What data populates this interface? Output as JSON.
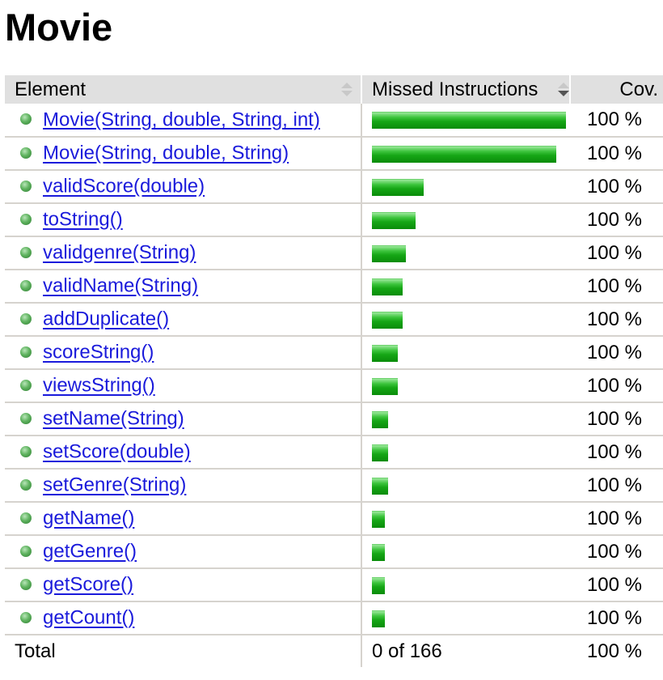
{
  "title": "Movie",
  "table": {
    "headers": {
      "element": "Element",
      "missed": "Missed Instructions",
      "cov": "Cov."
    },
    "sort": {
      "element": "sortable",
      "missed": "sorted-descending"
    },
    "rows": [
      {
        "name": "Movie(String, double, String, int)",
        "bar_fraction": 1.0,
        "cov": "100 %"
      },
      {
        "name": "Movie(String, double, String)",
        "bar_fraction": 0.95,
        "cov": "100 %"
      },
      {
        "name": "validScore(double)",
        "bar_fraction": 0.265,
        "cov": "100 %"
      },
      {
        "name": "toString()",
        "bar_fraction": 0.225,
        "cov": "100 %"
      },
      {
        "name": "validgenre(String)",
        "bar_fraction": 0.175,
        "cov": "100 %"
      },
      {
        "name": "validName(String)",
        "bar_fraction": 0.158,
        "cov": "100 %"
      },
      {
        "name": "addDuplicate()",
        "bar_fraction": 0.158,
        "cov": "100 %"
      },
      {
        "name": "scoreString()",
        "bar_fraction": 0.133,
        "cov": "100 %"
      },
      {
        "name": "viewsString()",
        "bar_fraction": 0.133,
        "cov": "100 %"
      },
      {
        "name": "setName(String)",
        "bar_fraction": 0.083,
        "cov": "100 %"
      },
      {
        "name": "setScore(double)",
        "bar_fraction": 0.083,
        "cov": "100 %"
      },
      {
        "name": "setGenre(String)",
        "bar_fraction": 0.083,
        "cov": "100 %"
      },
      {
        "name": "getName()",
        "bar_fraction": 0.066,
        "cov": "100 %"
      },
      {
        "name": "getGenre()",
        "bar_fraction": 0.066,
        "cov": "100 %"
      },
      {
        "name": "getScore()",
        "bar_fraction": 0.066,
        "cov": "100 %"
      },
      {
        "name": "getCount()",
        "bar_fraction": 0.066,
        "cov": "100 %"
      }
    ],
    "total": {
      "label": "Total",
      "missed": "0 of 166",
      "cov": "100 %"
    }
  },
  "colors": {
    "bar": "#16a616",
    "link": "#1a1adb",
    "header_bg": "#e0e0e0",
    "row_border": "#d6d3ce"
  }
}
